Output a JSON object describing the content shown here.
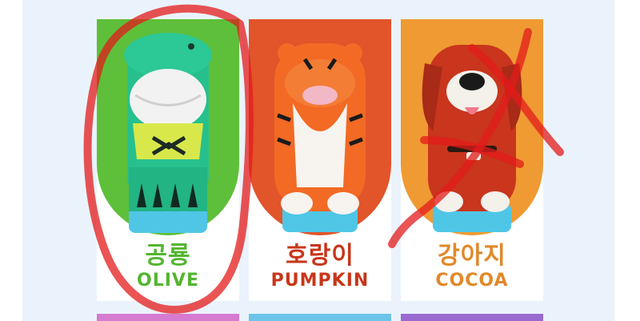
{
  "products": [
    {
      "name_kr": "공룡",
      "name_en": "OLIVE",
      "bg_color": "#5ebf3a",
      "text_color": "#54b531",
      "icon": "dinosaur-figure"
    },
    {
      "name_kr": "호랑이",
      "name_en": "PUMPKIN",
      "bg_color": "#e2542a",
      "text_color": "#c8361a",
      "icon": "tiger-figure"
    },
    {
      "name_kr": "강아지",
      "name_en": "COCOA",
      "bg_color": "#ef9a32",
      "text_color": "#e0892a",
      "icon": "dog-figure"
    }
  ],
  "next_row_colors": [
    "#d67bd0",
    "#6cc4e8",
    "#9a6ad0"
  ],
  "annotation_colors": {
    "circle": "#e31b1b",
    "cross": "#e31b1b"
  }
}
